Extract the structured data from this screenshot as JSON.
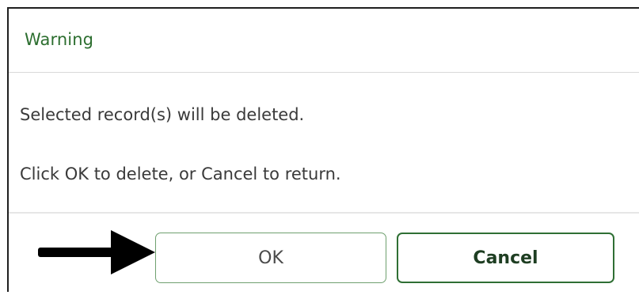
{
  "dialog": {
    "title": "Warning",
    "message_line1": "Selected record(s) will be deleted.",
    "message_line2": "Click OK to delete, or Cancel to return."
  },
  "buttons": {
    "ok_label": "OK",
    "cancel_label": "Cancel"
  },
  "icons": {
    "annotation": "arrow-right-icon"
  },
  "colors": {
    "title": "#2c6e2f",
    "ok_border": "#6fa06f",
    "cancel_border": "#2f6f34",
    "arrow": "#000000"
  }
}
